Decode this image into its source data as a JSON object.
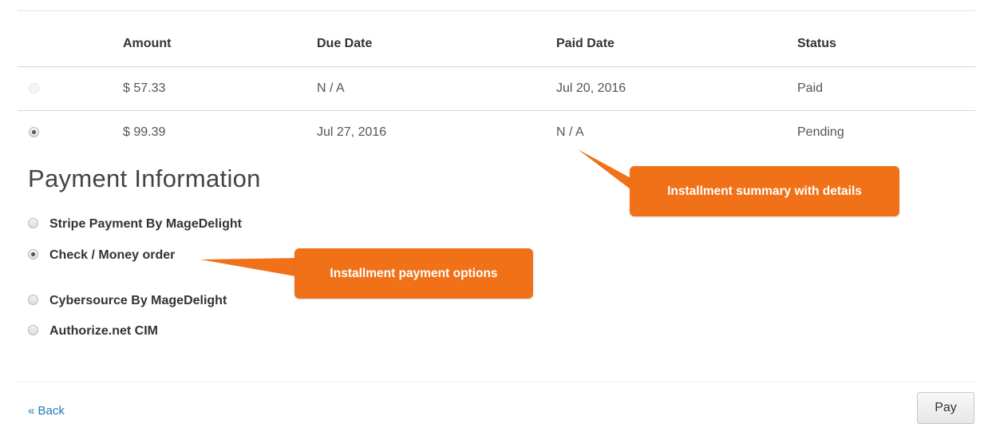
{
  "table": {
    "headers": [
      "Amount",
      "Due Date",
      "Paid Date",
      "Status"
    ],
    "rows": [
      {
        "amount": "$ 57.33",
        "due_date": "N / A",
        "paid_date": "Jul 20, 2016",
        "status": "Paid",
        "selected": false,
        "disabled": true
      },
      {
        "amount": "$ 99.39",
        "due_date": "Jul 27, 2016",
        "paid_date": "N / A",
        "status": "Pending",
        "selected": true,
        "disabled": false
      }
    ]
  },
  "payment": {
    "title": "Payment Information",
    "methods": [
      {
        "label": "Stripe Payment By MageDelight",
        "selected": false
      },
      {
        "label": "Check / Money order",
        "selected": true
      },
      {
        "label": "Cybersource By MageDelight",
        "selected": false
      },
      {
        "label": "Authorize.net CIM",
        "selected": false
      }
    ]
  },
  "callouts": {
    "summary": "Installment summary with details",
    "options": "Installment payment options"
  },
  "footer": {
    "back_label": "« Back",
    "pay_label": "Pay"
  },
  "colors": {
    "callout": "#f07117",
    "link": "#1f7ab8"
  }
}
